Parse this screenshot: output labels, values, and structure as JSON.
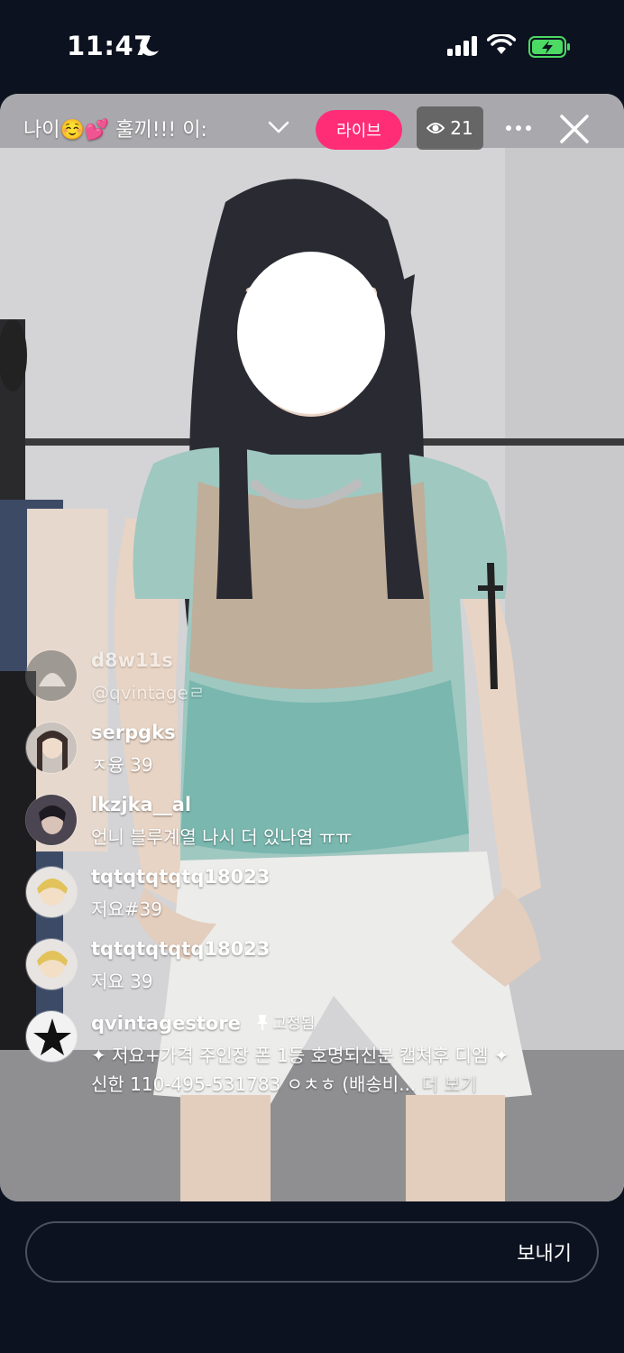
{
  "status_bar": {
    "time": "11:47",
    "icons": [
      "moon-icon",
      "signal-icon",
      "wifi-icon",
      "battery-charging-icon"
    ]
  },
  "top_bar": {
    "title": "나이☺️💕 훌끼!!! 이:",
    "live_badge": "라이브",
    "viewer_count": "21",
    "icons": [
      "chevron-down-icon",
      "eye-icon",
      "more-icon",
      "close-icon"
    ]
  },
  "comments": [
    {
      "user": "d8w11s",
      "text": "@qvintageㄹ",
      "faded": true
    },
    {
      "user": "serpgks",
      "text": "ㅈ융 39"
    },
    {
      "user": "lkzjka__al",
      "text": "언니 블루계열 나시 더 있나염 ㅠㅠ"
    },
    {
      "user": "tqtqtqtqtq18023",
      "text": "저요#39"
    },
    {
      "user": "tqtqtqtqtq18023",
      "text": "저요 39"
    }
  ],
  "pinned": {
    "user": "qvintagestore",
    "label": "고정됨",
    "line1": "✦ 저요+가격 주인장 폰 1등 호명되신분 캡쳐후 디엠 ✦",
    "line2": "신한 110-495-531783 ㅇㅊㅎ (배송비...",
    "more": "더 보기"
  },
  "composer": {
    "send_label": "보내기"
  },
  "colors": {
    "background": "#0c1220",
    "live_badge": "#ff2d75",
    "battery": "#4cd964"
  }
}
